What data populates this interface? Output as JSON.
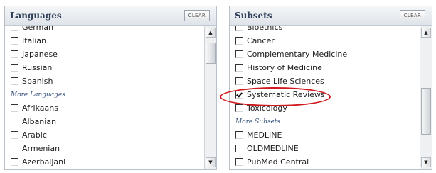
{
  "languages": {
    "title": "Languages",
    "clear_label": "CLEAR",
    "items": [
      "German",
      "Italian",
      "Japanese",
      "Russian",
      "Spanish"
    ],
    "more_label": "More Languages",
    "more_items": [
      "Afrikaans",
      "Albanian",
      "Arabic",
      "Armenian",
      "Azerbaijani"
    ]
  },
  "subsets": {
    "title": "Subsets",
    "clear_label": "CLEAR",
    "items": [
      {
        "label": "Bioethics",
        "checked": false
      },
      {
        "label": "Cancer",
        "checked": false
      },
      {
        "label": "Complementary Medicine",
        "checked": false
      },
      {
        "label": "History of Medicine",
        "checked": false
      },
      {
        "label": "Space Life Sciences",
        "checked": false
      },
      {
        "label": "Systematic Reviews",
        "checked": true
      },
      {
        "label": "Toxicology",
        "checked": false
      }
    ],
    "more_label": "More Subsets",
    "more_items": [
      "MEDLINE",
      "OLDMEDLINE",
      "PubMed Central"
    ]
  },
  "icons": {
    "scroll_up": "▲",
    "scroll_down": "▼"
  },
  "colors": {
    "highlight": "#d0191d",
    "header_text": "#2e3f57",
    "section_label": "#36507a"
  }
}
